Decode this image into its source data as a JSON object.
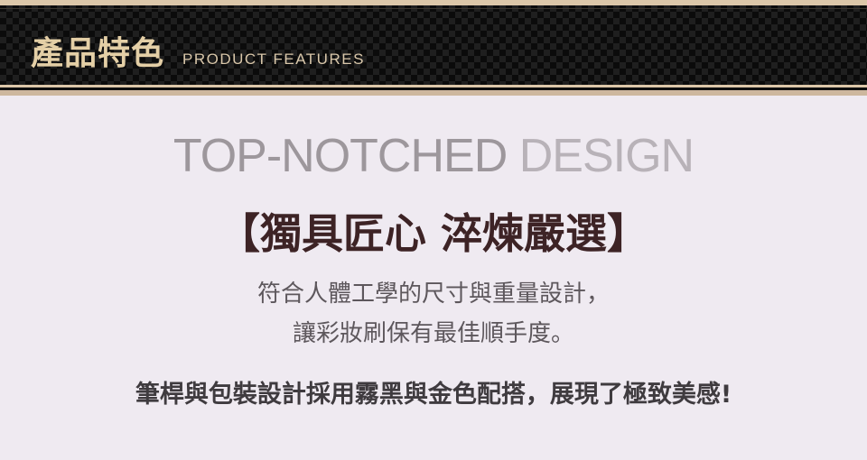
{
  "banner": {
    "title_zh": "產品特色",
    "title_en": "PRODUCT FEATURES"
  },
  "headline": {
    "part1": "TOP-NOTCHED",
    "part2": "DESIGN"
  },
  "subtitle": "【獨具匠心 淬煉嚴選】",
  "description": {
    "line1": "符合人體工學的尺寸與重量設計，",
    "line2": "讓彩妝刷保有最佳順手度。"
  },
  "feature": "筆桿與包裝設計採用霧黑與金色配搭，展現了極致美感!",
  "colors": {
    "gold": "#e4cfa6",
    "banner_black": "#0b0b0b",
    "background": "#efeaf1",
    "subtitle_brown": "#3d2325"
  }
}
